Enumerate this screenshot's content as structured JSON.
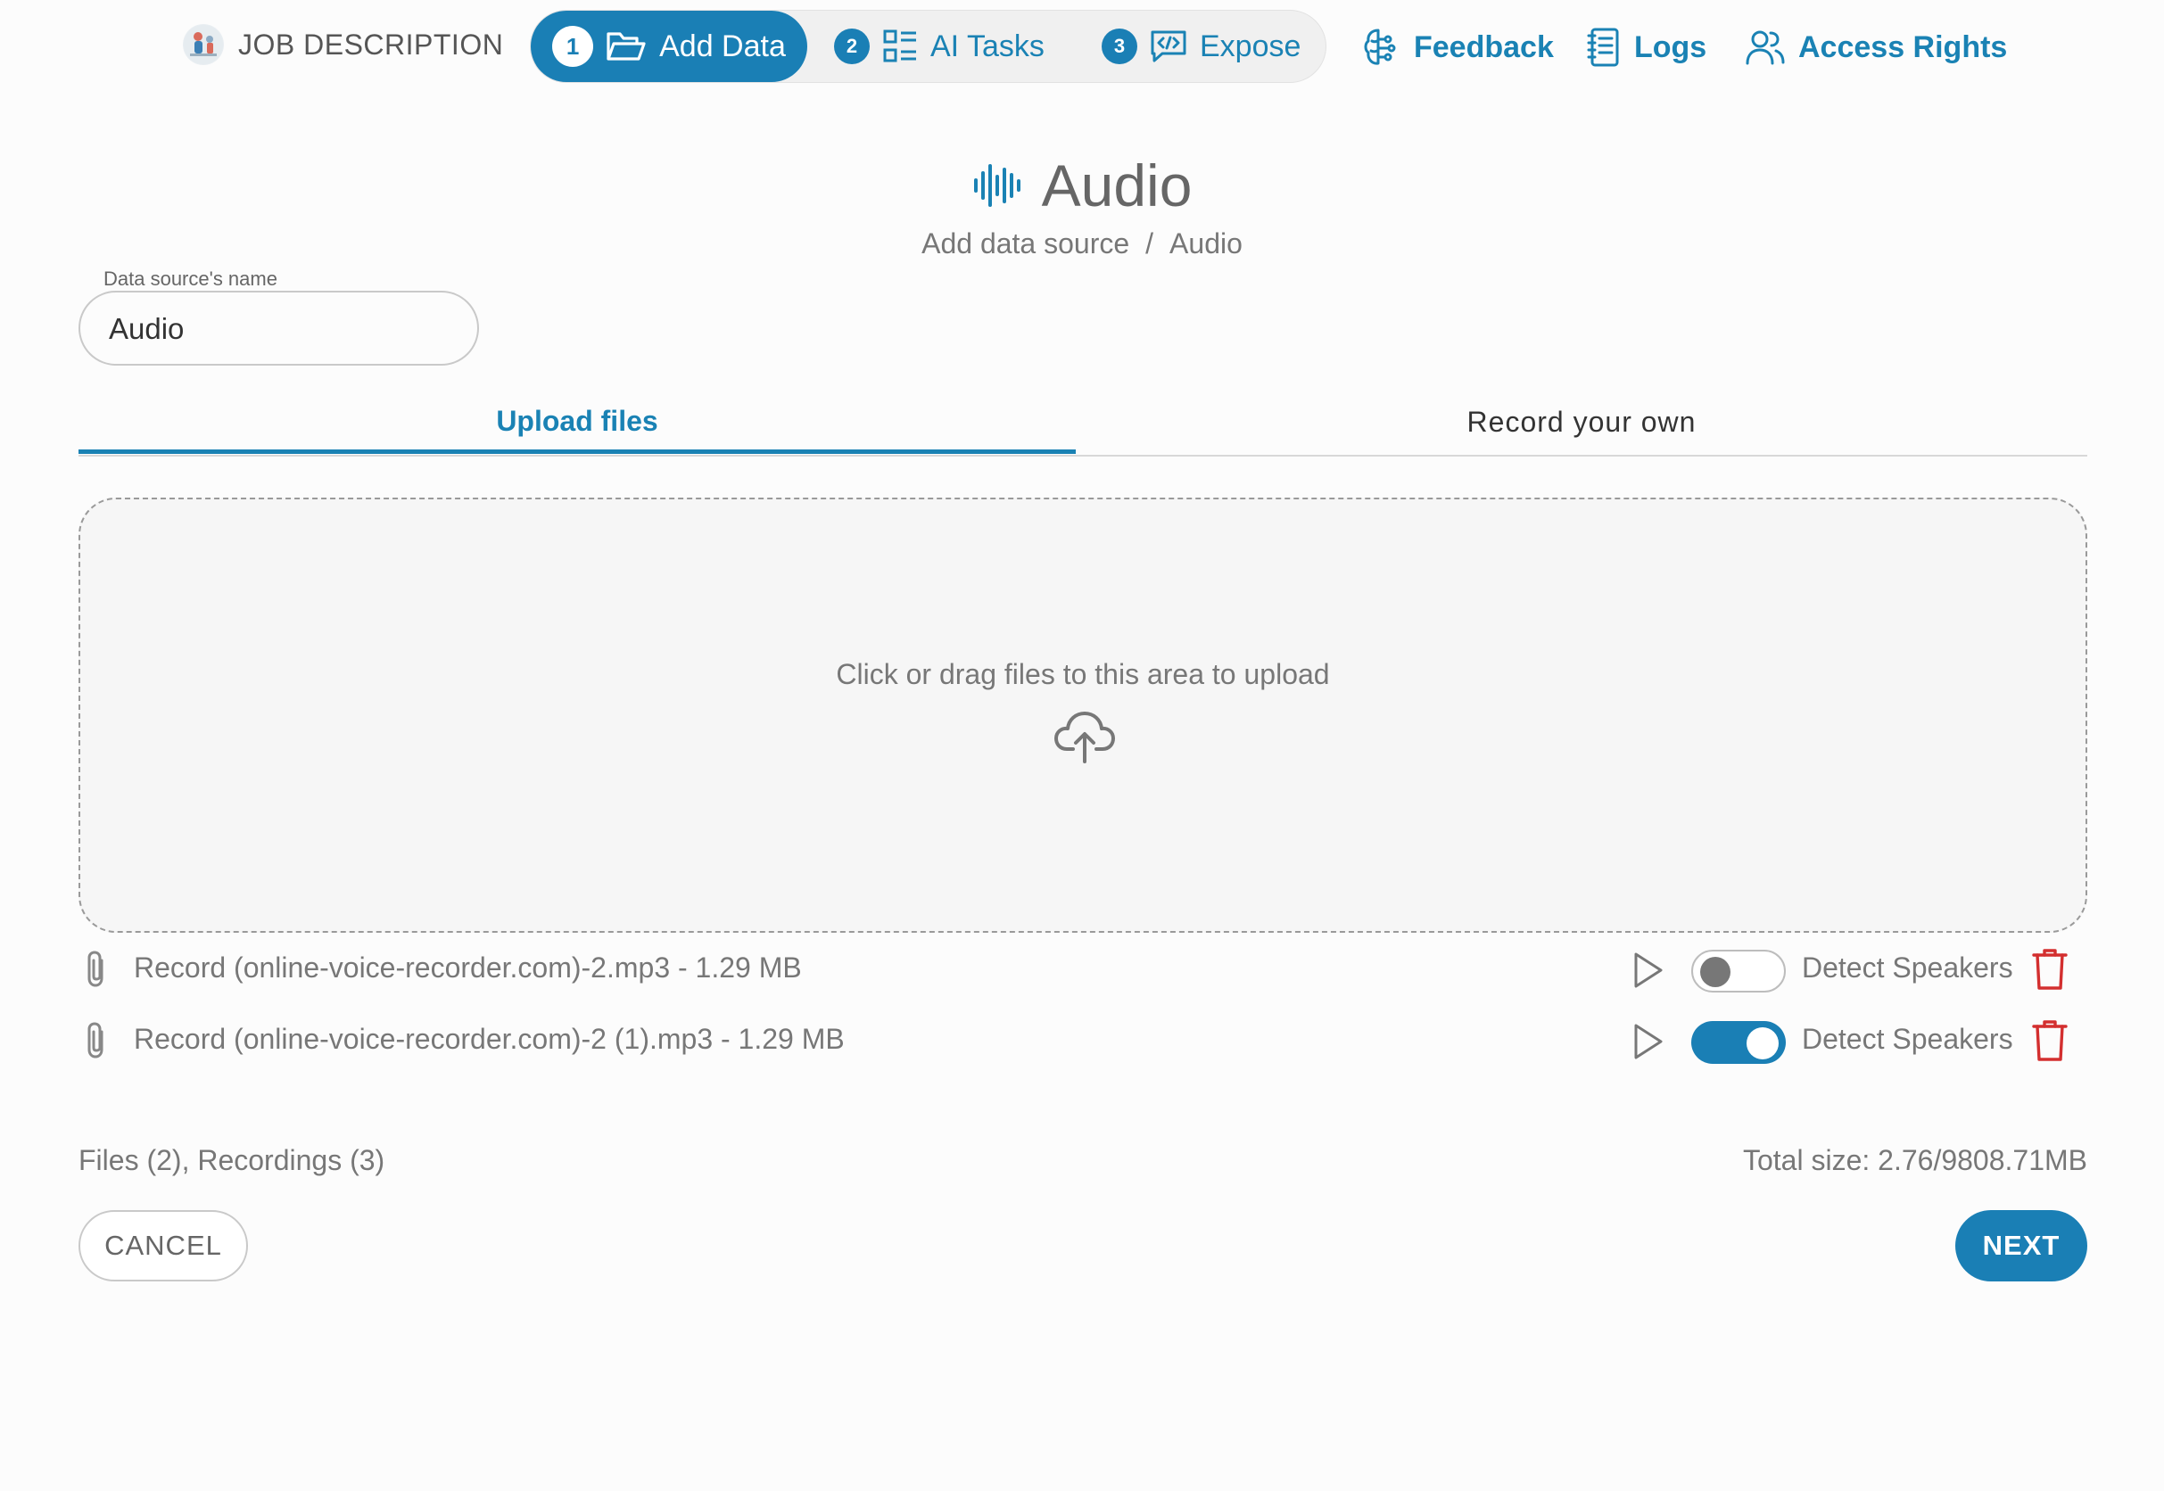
{
  "nav": {
    "job_label": "JOB DESCRIPTION",
    "steps": [
      {
        "number": "1",
        "label": "Add Data",
        "icon": "folder-open-icon",
        "active": true
      },
      {
        "number": "2",
        "label": "AI Tasks",
        "icon": "list-icon",
        "active": false
      },
      {
        "number": "3",
        "label": "Expose",
        "icon": "code-message-icon",
        "active": false
      }
    ],
    "links": [
      {
        "label": "Feedback",
        "icon": "brain-icon"
      },
      {
        "label": "Logs",
        "icon": "notebook-icon"
      },
      {
        "label": "Access Rights",
        "icon": "users-icon"
      }
    ]
  },
  "header": {
    "title": "Audio",
    "title_icon": "audio-wave-icon",
    "breadcrumb": [
      "Add data source",
      "/",
      "Audio"
    ]
  },
  "name_field": {
    "label": "Data source's name",
    "value": "Audio"
  },
  "tabs": [
    {
      "label": "Upload files",
      "active": true
    },
    {
      "label": "Record your own",
      "active": false
    }
  ],
  "dropzone": {
    "text": "Click or drag files to this area to upload",
    "icon": "cloud-upload-icon"
  },
  "files": [
    {
      "name": "Record (online-voice-recorder.com)-2.mp3 - 1.29 MB",
      "detect_label": "Detect Speakers",
      "detect_speakers": false
    },
    {
      "name": "Record (online-voice-recorder.com)-2 (1).mp3 - 1.29 MB",
      "detect_label": "Detect Speakers",
      "detect_speakers": true
    }
  ],
  "footer": {
    "counts": "Files (2), Recordings (3)",
    "total_size": "Total size: 2.76/9808.71MB",
    "cancel_label": "CANCEL",
    "next_label": "NEXT"
  },
  "colors": {
    "accent": "#1a7fb5",
    "danger": "#d32f2f",
    "text": "#777777"
  }
}
